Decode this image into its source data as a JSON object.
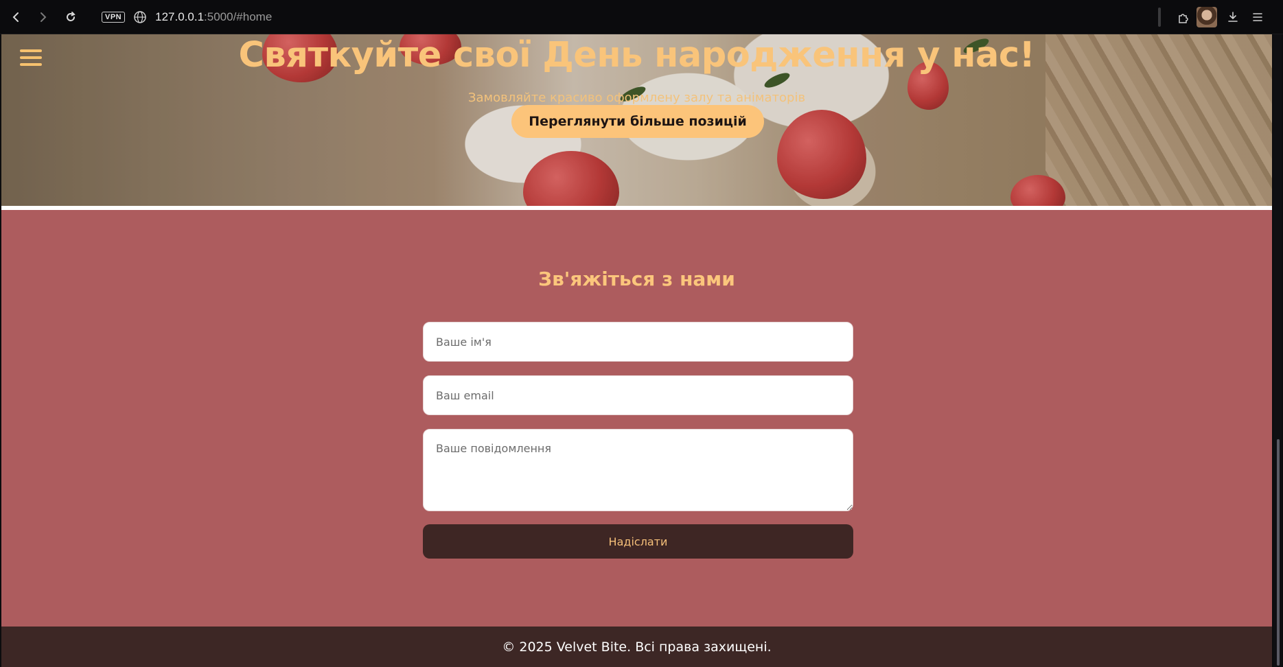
{
  "browser": {
    "vpn_label": "VPN",
    "url_host": "127.0.0.1",
    "url_rest": ":5000/#home",
    "icons": [
      "back-icon",
      "forward-icon",
      "reload-icon",
      "globe-icon",
      "extensions-icon",
      "download-icon",
      "menu-icon"
    ]
  },
  "hero": {
    "title": "Святкуйте свої День народження у нас!",
    "subtitle": "Замовляйте красиво оформлену залу та аніматорів",
    "cta_label": "Переглянути більше позицій"
  },
  "contact": {
    "title": "Зв'яжіться з нами",
    "name_placeholder": "Ваше ім'я",
    "email_placeholder": "Ваш email",
    "message_placeholder": "Ваше повідомлення",
    "submit_label": "Надіслати"
  },
  "footer": {
    "text": "© 2025 Velvet Bite. Всі права захищені."
  },
  "colors": {
    "accent": "#fcc47a",
    "section_bg": "#ad5c5e",
    "dark": "#3d2725"
  }
}
